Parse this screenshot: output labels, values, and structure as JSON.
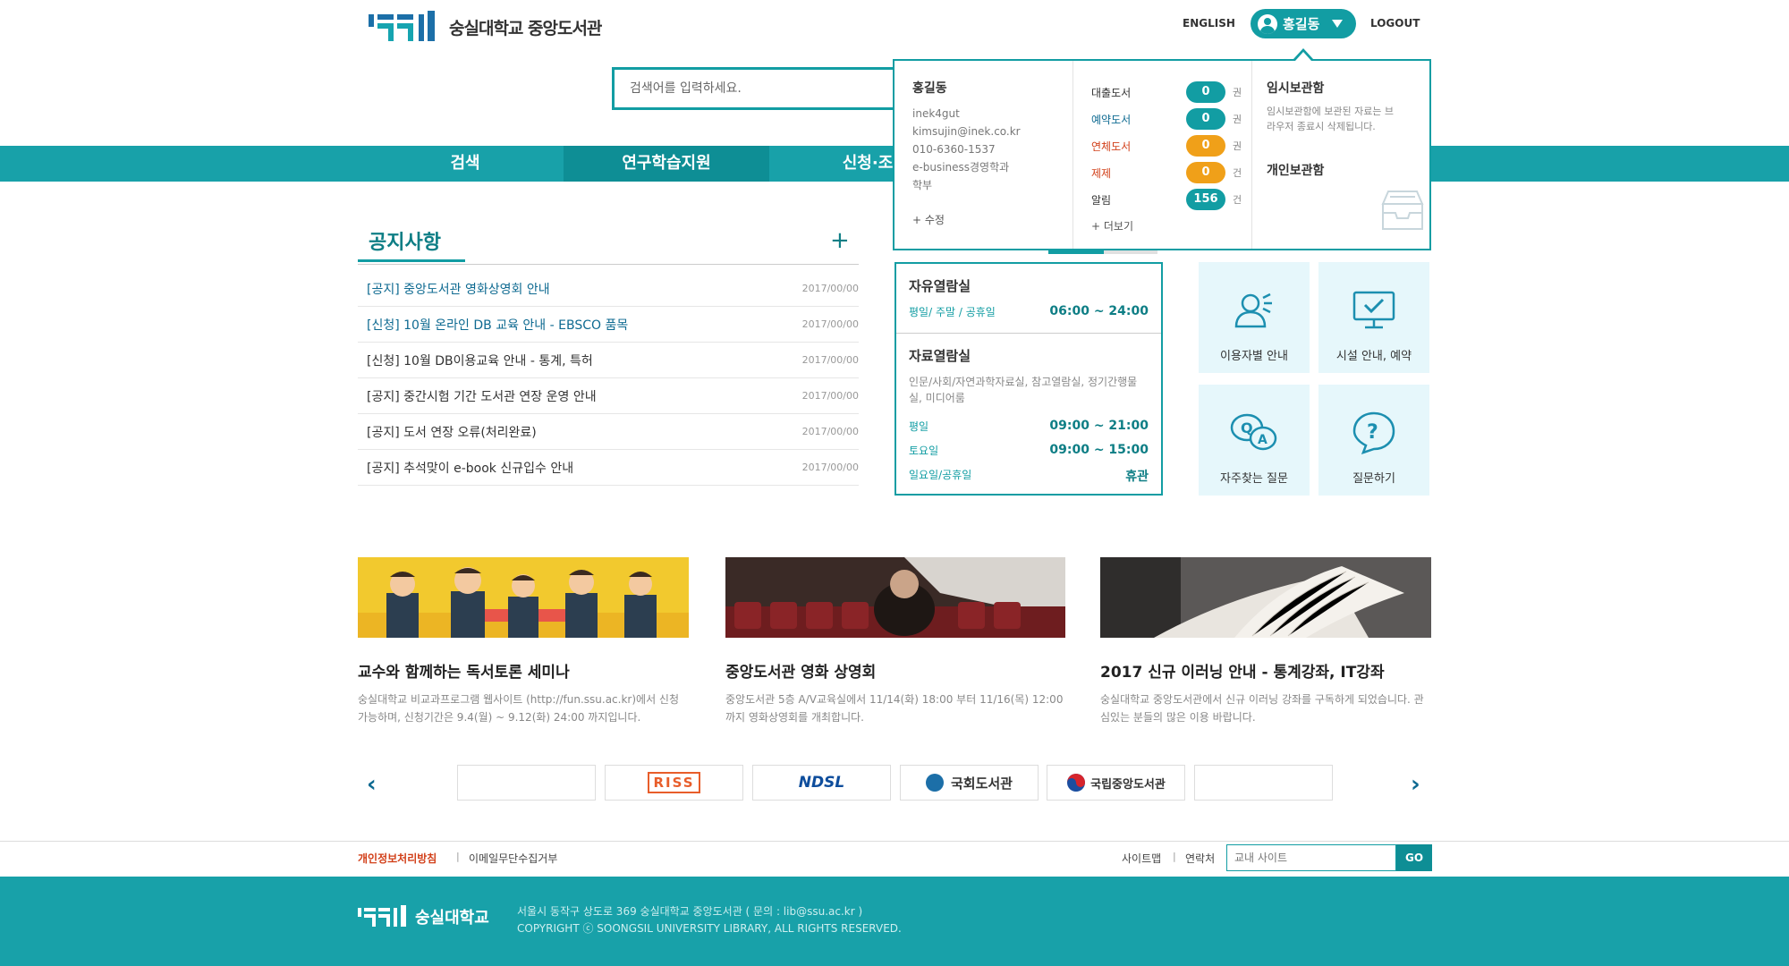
{
  "header": {
    "logo_text": "숭실대학교 중앙도서관",
    "english": "ENGLISH",
    "user_name": "홍길동",
    "logout": "LOGOUT"
  },
  "search": {
    "placeholder": "검색어를 입력하세요."
  },
  "nav": {
    "items": [
      {
        "label": "검색"
      },
      {
        "label": "연구학습지원"
      },
      {
        "label": "신청·조"
      }
    ]
  },
  "user_panel": {
    "name": "홍길동",
    "id": "inek4gut",
    "email": "kimsujin@inek.co.kr",
    "phone": "010-6360-1537",
    "dept": "e-business경영학과",
    "type": "학부",
    "edit": "+ 수정",
    "stats": [
      {
        "label": "대출도서",
        "count": "0",
        "unit": "권",
        "color": "#129da3",
        "label_color": "#333333"
      },
      {
        "label": "예약도서",
        "count": "0",
        "unit": "권",
        "color": "#129da3",
        "label_color": "#0e6a91"
      },
      {
        "label": "연체도서",
        "count": "0",
        "unit": "권",
        "color": "#f0a019",
        "label_color": "#d2401a"
      },
      {
        "label": "제제",
        "count": "0",
        "unit": "건",
        "color": "#f0a019",
        "label_color": "#d2401a"
      },
      {
        "label": "알림",
        "count": "156",
        "unit": "건",
        "color": "#129da3",
        "label_color": "#333333"
      }
    ],
    "more": "+ 더보기",
    "temp_title": "임시보관함",
    "temp_desc": "임시보관함에 보관된 자료는 브라우저 종료시 삭제됩니다.",
    "personal_title": "개인보관함"
  },
  "notice": {
    "title": "공지사항",
    "plus": "+",
    "items": [
      {
        "text": "[공지] 중앙도서관 영화상영회 안내",
        "date": "2017/00/00"
      },
      {
        "text": "[신청] 10월 온라인 DB 교육 안내 - EBSCO 품목",
        "date": "2017/00/00"
      },
      {
        "text": "[신청] 10월 DB이용교육 안내 - 통계, 특허",
        "date": "2017/00/00"
      },
      {
        "text": "[공지] 중간시험 기간 도서관 연장 운영 안내",
        "date": "2017/00/00"
      },
      {
        "text": "[공지] 도서 연장 오류(처리완료)",
        "date": "2017/00/00"
      },
      {
        "text": "[공지] 추석맞이 e-book 신규입수 안내",
        "date": "2017/00/00"
      }
    ]
  },
  "hours": {
    "free_title": "자유열람실",
    "free_label": "평일/ 주말 / 공휴일",
    "free_time": "06:00 ~ 24:00",
    "material_title": "자료열람실",
    "material_desc": "인문/사회/자연과학자료실, 참고열람실, 정기간행물실, 미디어룸",
    "rows": [
      {
        "label": "평일",
        "time": "09:00 ~ 21:00"
      },
      {
        "label": "토요일",
        "time": "09:00 ~ 15:00"
      },
      {
        "label": "일요일/공휴일",
        "time": "휴관"
      }
    ]
  },
  "tiles": {
    "user_guide": "이용자별 안내",
    "facility": "시설 안내, 예약",
    "faq": "자주찾는 질문",
    "ask": "질문하기"
  },
  "cards": [
    {
      "title": "교수와 함께하는 독서토론 세미나",
      "desc": "숭실대학교 비교과프로그램 웹사이트 (http://fun.ssu.ac.kr)에서 신청가능하며, 신청기간은 9.4(월) ~ 9.12(화) 24:00 까지입니다."
    },
    {
      "title": "중앙도서관 영화 상영회",
      "desc": "중앙도서관 5층 A/V교육실에서 11/14(화) 18:00 부터 11/16(목) 12:00 까지 영화상영회를 개최합니다."
    },
    {
      "title": "2017 신규 이러닝 안내 - 통계강좌, IT강좌",
      "desc": "숭실대학교 중앙도서관에서 신규 이러닝 강좌를 구독하게 되었습니다. 관심있는 분들의 많은 이용 바랍니다."
    }
  ],
  "partners": {
    "riss": "RISS",
    "ndsl": "NDSL",
    "nanet": "국회도서관",
    "nlk": "국립중앙도서관"
  },
  "footer": {
    "privacy": "개인정보처리방침",
    "email_refuse": "이메일무단수집거부",
    "sitemap": "사이트맵",
    "contact": "연락처",
    "site_search_placeholder": "교내 사이트",
    "go": "GO",
    "logo_text": "숭실대학교",
    "address": "서울시 동작구 상도로 369  숭실대학교 중앙도서관 ( 문의 : lib@ssu.ac.kr )",
    "copyright": "COPYRIGHT  ⓒ  SOONGSIL UNIVERSITY LIBRARY, ALL RIGHTS RESERVED.",
    "separator": "|"
  },
  "colors": {
    "brand": "#129da3",
    "accent_orange": "#f0a019",
    "alert_red": "#d2401a"
  }
}
